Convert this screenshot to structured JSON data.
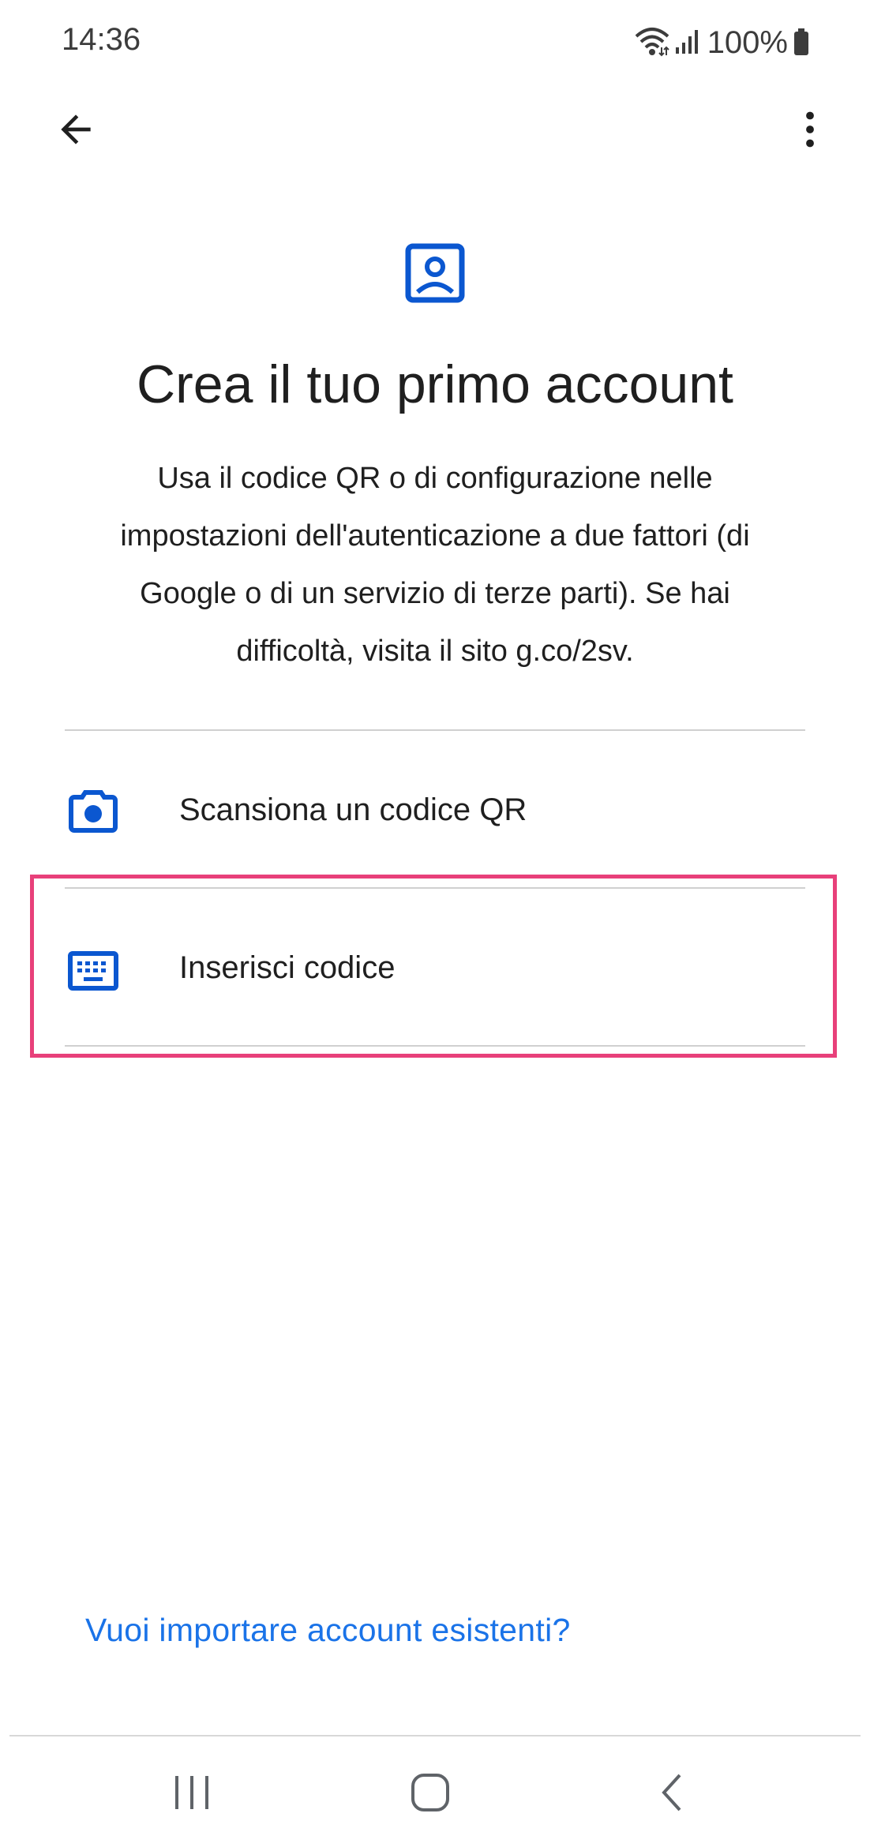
{
  "status_bar": {
    "time": "14:36",
    "battery": "100%",
    "icons": [
      "wifi-icon",
      "signal-icon",
      "battery-icon"
    ]
  },
  "app_bar": {
    "back_icon": "arrow-back-icon",
    "more_icon": "more-vert-icon"
  },
  "hero": {
    "icon": "account-box-icon",
    "title": "Crea il tuo primo account",
    "description": "Usa il codice QR o di configurazione nelle impostazioni dell'autenticazione a due fattori (di Google o di un servizio di terze parti). Se hai difficoltà, visita il sito g.co/2sv."
  },
  "options": [
    {
      "icon": "camera-icon",
      "label": "Scansiona un codice QR"
    },
    {
      "icon": "keyboard-icon",
      "label": "Inserisci codice"
    }
  ],
  "import_link": "Vuoi importare account esistenti?",
  "nav_bar": {
    "recents_icon": "recents-icon",
    "home_icon": "home-icon",
    "back_icon": "nav-back-icon"
  },
  "colors": {
    "accent": "#0b57d0",
    "link": "#1a73e8",
    "highlight": "#e8407a",
    "text": "#1f1f1f"
  }
}
